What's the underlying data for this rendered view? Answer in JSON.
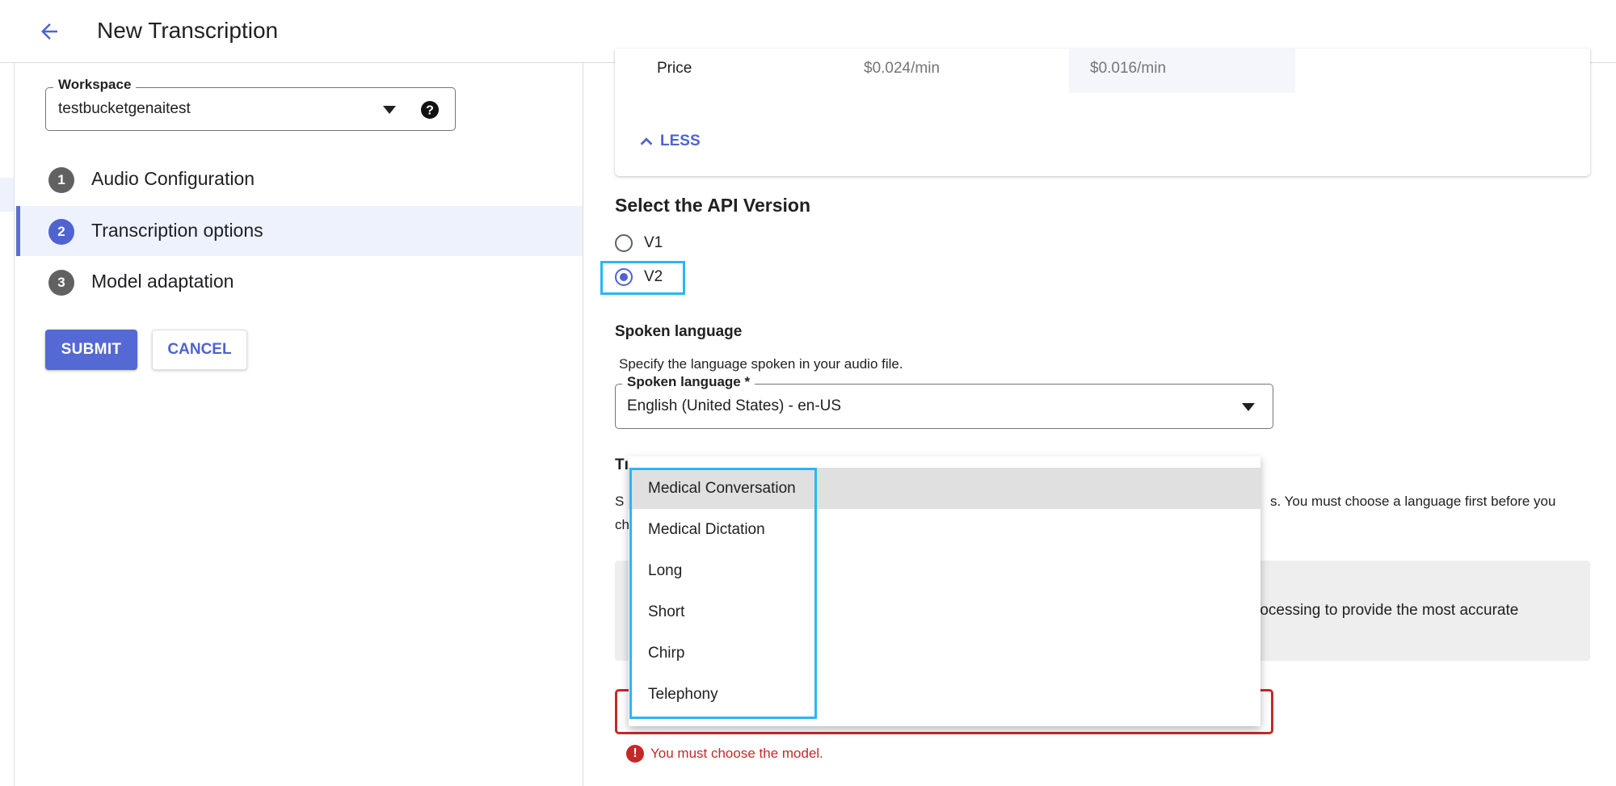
{
  "header": {
    "title": "New Transcription"
  },
  "workspace": {
    "label": "Workspace",
    "value": "testbucketgenaitest"
  },
  "steps": [
    {
      "number": "1",
      "label": "Audio Configuration"
    },
    {
      "number": "2",
      "label": "Transcription options"
    },
    {
      "number": "3",
      "label": "Model adaptation"
    }
  ],
  "actions": {
    "submit": "SUBMIT",
    "cancel": "CANCEL"
  },
  "price": {
    "label": "Price",
    "v1": "$0.024/min",
    "v2": "$0.016/min",
    "less": "LESS"
  },
  "api_version": {
    "heading": "Select the API Version",
    "options": [
      {
        "label": "V1"
      },
      {
        "label": "V2"
      }
    ],
    "selected": "V2"
  },
  "spoken_language": {
    "heading": "Spoken language",
    "help": "Specify the language spoken in your audio file.",
    "field_label": "Spoken language *",
    "value": "English (United States) - en-US"
  },
  "model": {
    "heading_visible": "Tı",
    "help_visible_start": "S",
    "help_visible_end": "s. You must choose a language first before you",
    "help_line2_visible": "ch",
    "info_visible": "rocessing to provide the most accurate",
    "error": "You must choose the model."
  },
  "dropdown": {
    "items": [
      "Medical Conversation",
      "Medical Dictation",
      "Long",
      "Short",
      "Chirp",
      "Telephony"
    ],
    "selected": "Medical Conversation"
  },
  "colors": {
    "primary": "#4f63d1",
    "error": "#c62828",
    "highlight": "#29b6f6"
  }
}
